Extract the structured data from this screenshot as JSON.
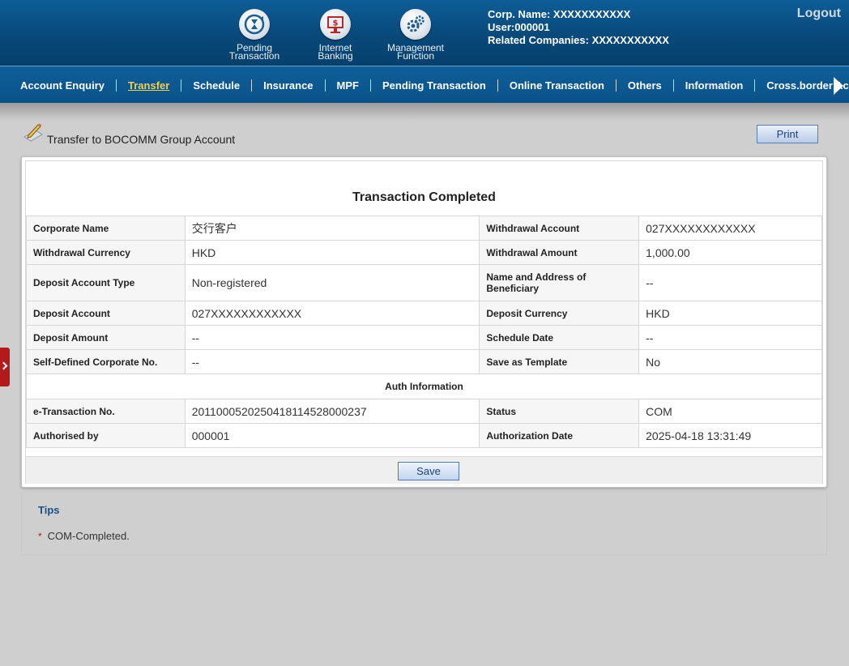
{
  "header": {
    "icons": [
      {
        "line1": "Pending",
        "line2": "Transaction",
        "icon": "hourglass-icon"
      },
      {
        "line1": "Internet",
        "line2": "Banking",
        "icon": "monitor-dollar-icon"
      },
      {
        "line1": "Management",
        "line2": "Function",
        "icon": "gears-icon"
      }
    ],
    "corp_name": "Corp. Name: XXXXXXXXXXX",
    "user": "User:000001",
    "related": "Related Companies: XXXXXXXXXXX",
    "logout": "Logout"
  },
  "nav": {
    "items": [
      "Account Enquiry",
      "Transfer",
      "Schedule",
      "Insurance",
      "MPF",
      "Pending Transaction",
      "Online Transaction",
      "Others",
      "Information",
      "Cross.border Ac"
    ],
    "active": "Transfer"
  },
  "page": {
    "title": "Transfer to BOCOMM Group Account",
    "print": "Print"
  },
  "transaction": {
    "heading": "Transaction Completed",
    "rows": [
      {
        "k1": "Corporate Name",
        "v1": "交行客户",
        "k2": "Withdrawal Account",
        "v2": "027XXXXXXXXXXXX"
      },
      {
        "k1": "Withdrawal Currency",
        "v1": "HKD",
        "k2": "Withdrawal Amount",
        "v2": "1,000.00"
      },
      {
        "k1": "Deposit Account Type",
        "v1": "Non-registered",
        "k2": "Name and Address of Beneficiary",
        "v2": "--"
      },
      {
        "k1": "Deposit Account",
        "v1": "027XXXXXXXXXXXX",
        "k2": "Deposit Currency",
        "v2": "HKD"
      },
      {
        "k1": "Deposit Amount",
        "v1": "--",
        "k2": "Schedule Date",
        "v2": "--"
      },
      {
        "k1": "Self-Defined Corporate No.",
        "v1": "--",
        "k2": "Save as Template",
        "v2": "No"
      }
    ],
    "auth_section": "Auth Information",
    "auth_rows": [
      {
        "k1": "e-Transaction No.",
        "v1": "2011000520250418114528000237",
        "k2": "Status",
        "v2": "COM"
      },
      {
        "k1": "Authorised by",
        "v1": "000001",
        "k2": "Authorization Date",
        "v2": "2025-04-18 13:31:49"
      }
    ],
    "save": "Save"
  },
  "tips": {
    "title": "Tips",
    "items": [
      "COM-Completed."
    ]
  },
  "colors": {
    "header_blue": "#08497a",
    "nav_active": "#f4d04a",
    "tips_title": "#1a4f86",
    "side_tab_red": "#b51a1a"
  }
}
